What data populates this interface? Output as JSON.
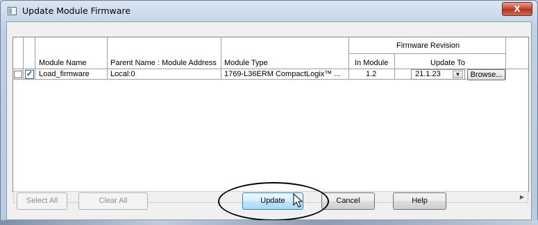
{
  "window": {
    "title": "Update Module Firmware",
    "close_label": "X"
  },
  "grid": {
    "headers": {
      "module_name": "Module Name",
      "parent_name": "Parent Name : Module Address",
      "module_type": "Module Type",
      "firmware_revision": "Firmware Revision",
      "in_module": "In Module",
      "update_to": "Update To"
    },
    "rows": [
      {
        "checked": true,
        "check_glyph": "✓",
        "module_name": "Load_firmware",
        "parent": "Local:0",
        "module_type": "1769-L36ERM CompactLogix™ ...",
        "in_module": "1.2",
        "update_to": "21.1.23",
        "browse_label": "Browse..."
      }
    ]
  },
  "scrollbar": {
    "left_arrow": "◀",
    "right_arrow": "▶"
  },
  "buttons": {
    "select_all": "Select All",
    "clear_all": "Clear All",
    "update": "Update",
    "cancel": "Cancel",
    "help": "Help"
  },
  "icons": {
    "dropdown": "▼"
  },
  "colors": {
    "annotation": "#000000",
    "checkmark": "#1d3f8e"
  }
}
